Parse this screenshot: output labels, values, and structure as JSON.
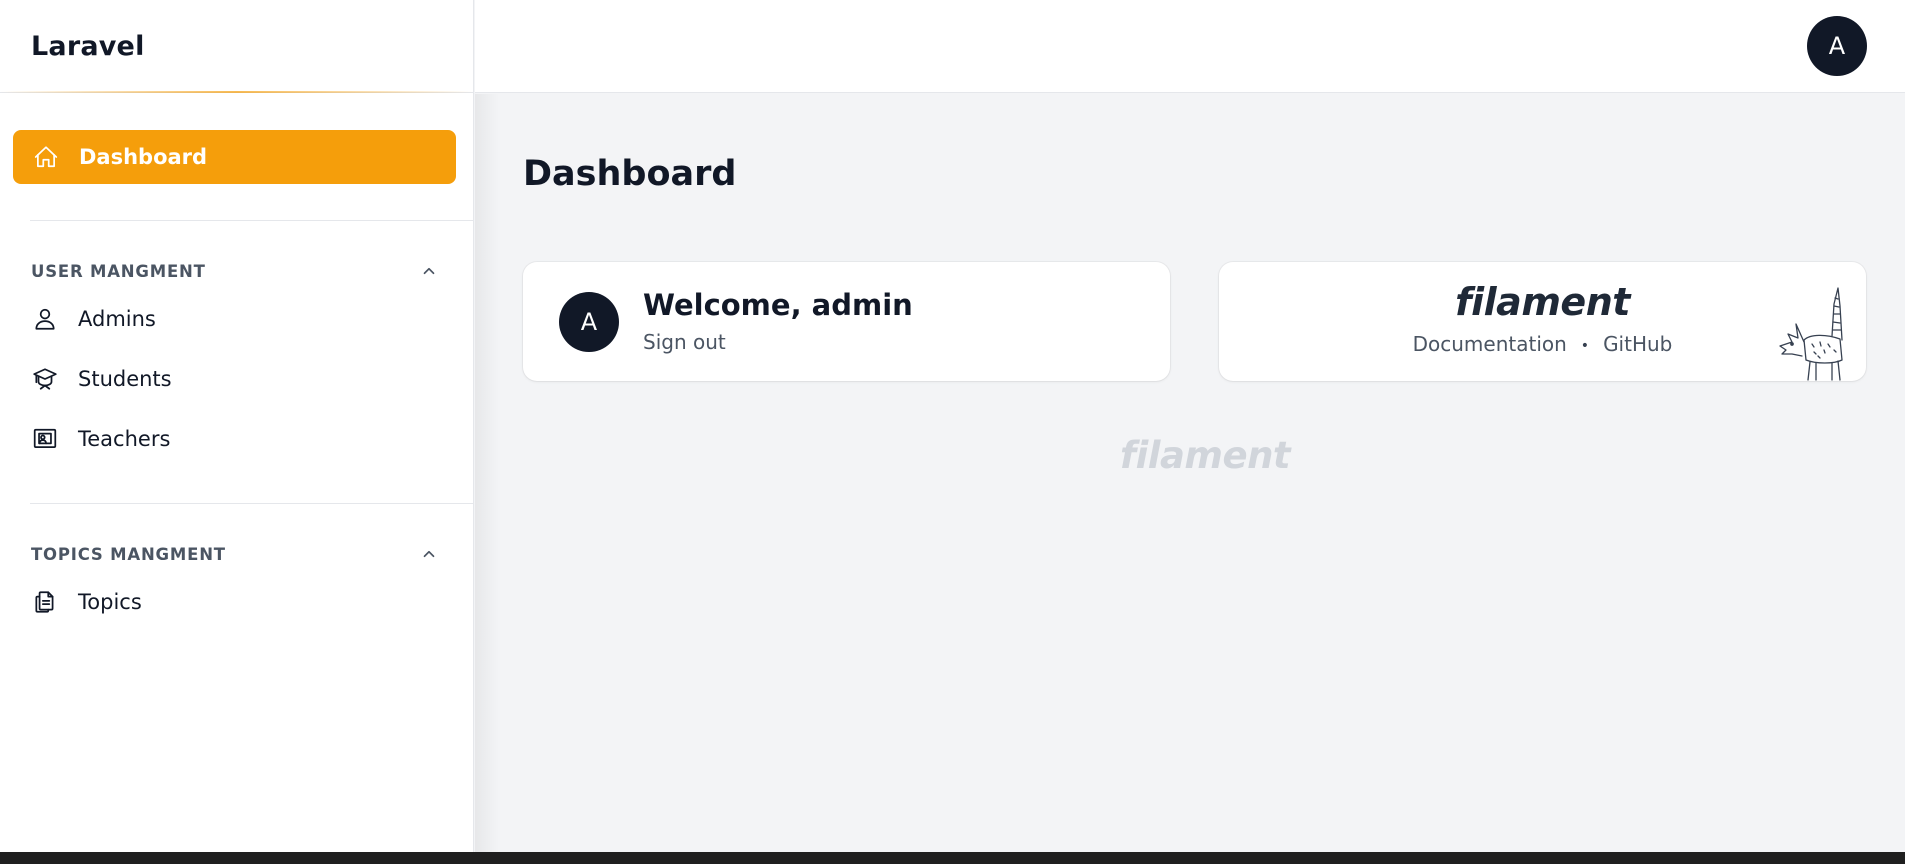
{
  "brand": {
    "name": "Laravel"
  },
  "sidebar": {
    "active_item": {
      "label": "Dashboard",
      "icon": "home-icon"
    },
    "groups": [
      {
        "label": "USER MANGMENT",
        "items": [
          {
            "label": "Admins",
            "icon": "user-icon"
          },
          {
            "label": "Students",
            "icon": "academic-cap-icon"
          },
          {
            "label": "Teachers",
            "icon": "presentation-icon"
          }
        ]
      },
      {
        "label": "TOPICS MANGMENT",
        "items": [
          {
            "label": "Topics",
            "icon": "document-duplicate-icon"
          }
        ]
      }
    ]
  },
  "topbar": {
    "avatar_initial": "A"
  },
  "main": {
    "title": "Dashboard",
    "welcome_card": {
      "avatar_initial": "A",
      "title": "Welcome, admin",
      "signout": "Sign out"
    },
    "filament_card": {
      "logo": "filament",
      "links": [
        "Documentation",
        "GitHub"
      ],
      "separator": "•"
    },
    "footer_logo": "filament"
  },
  "colors": {
    "accent": "#f59e0b",
    "avatar_bg": "#111827",
    "background": "#f3f4f6"
  }
}
